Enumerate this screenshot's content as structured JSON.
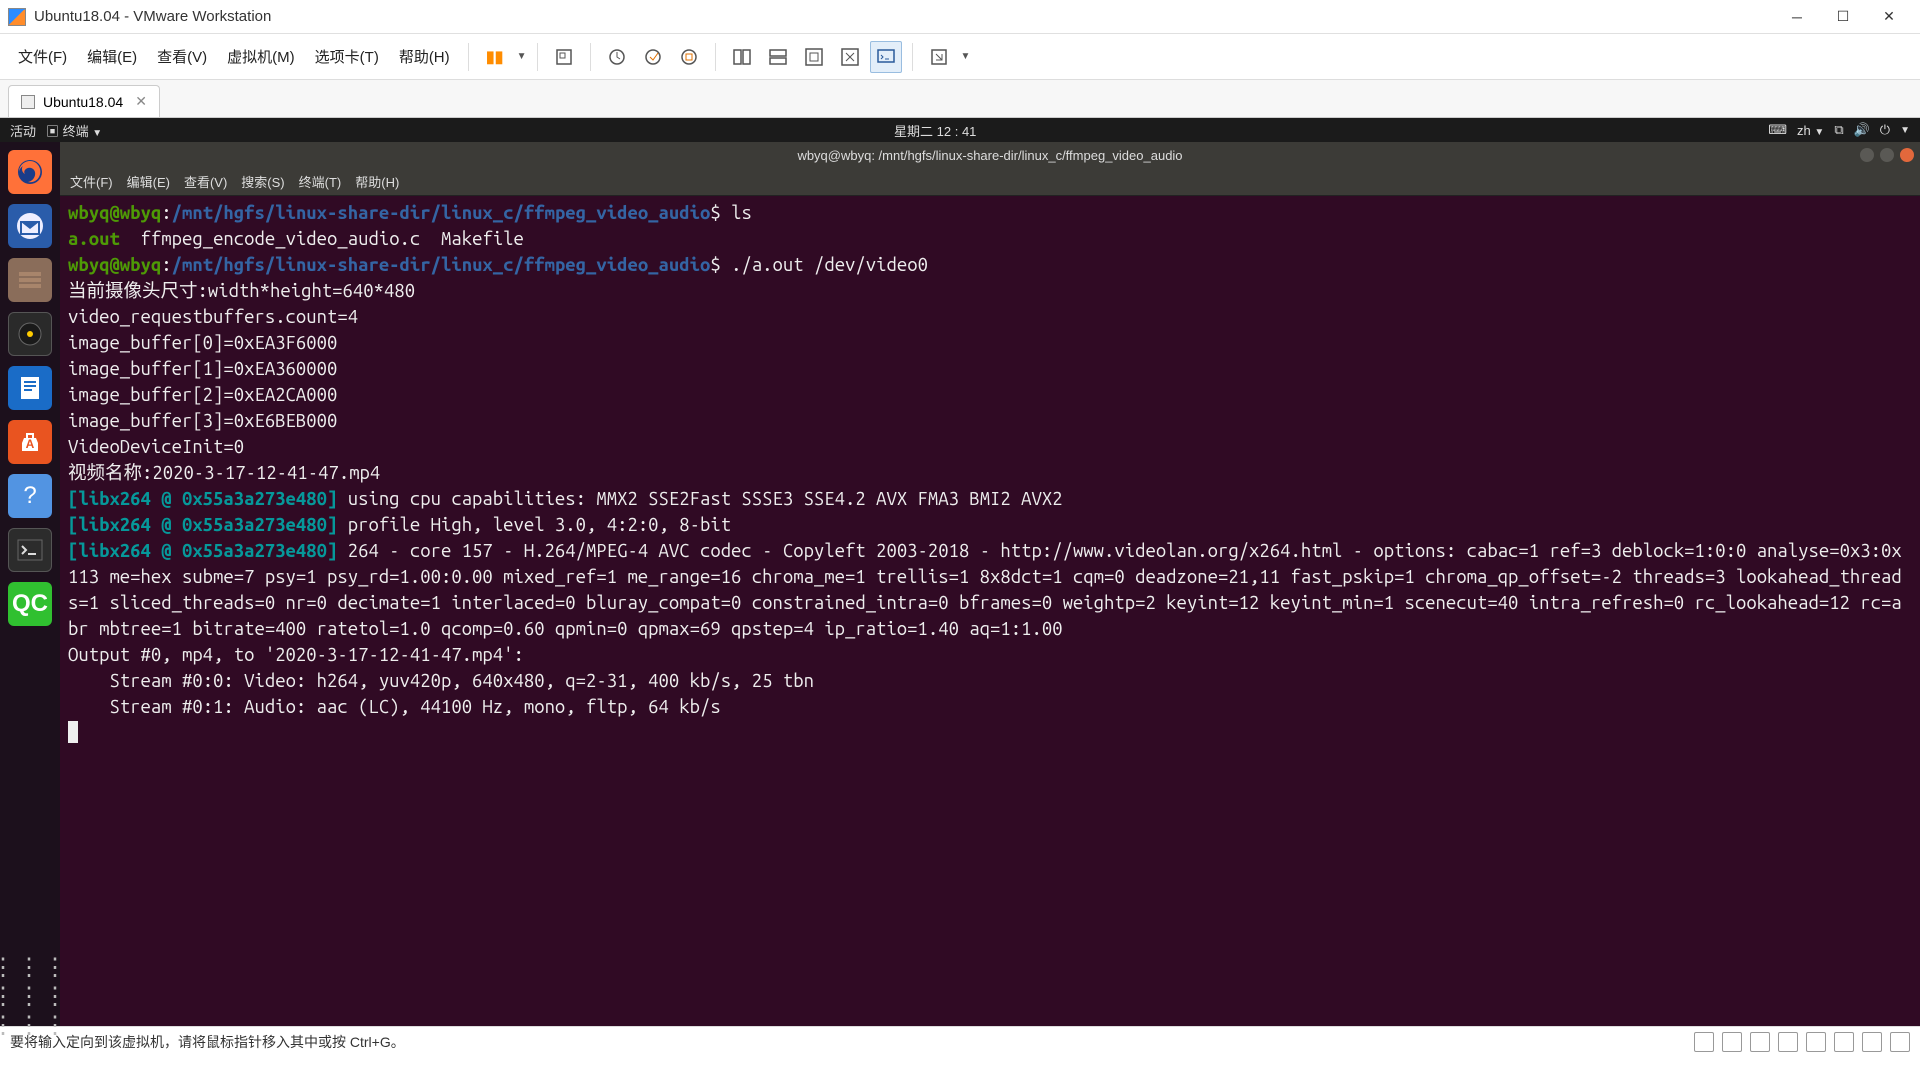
{
  "vmware": {
    "title": "Ubuntu18.04 - VMware Workstation",
    "menus": [
      "文件(F)",
      "编辑(E)",
      "查看(V)",
      "虚拟机(M)",
      "选项卡(T)",
      "帮助(H)"
    ],
    "tab_label": "Ubuntu18.04",
    "statusbar": "要将输入定向到该虚拟机，请将鼠标指针移入其中或按 Ctrl+G。"
  },
  "ubuntu_topbar": {
    "activities": "活动",
    "terminal_label": "终端",
    "datetime": "星期二 12 : 41",
    "lang": "zh"
  },
  "dock": {
    "qc_label": "QC"
  },
  "terminal": {
    "window_title": "wbyq@wbyq: /mnt/hgfs/linux-share-dir/linux_c/ffmpeg_video_audio",
    "menus": [
      "文件(F)",
      "编辑(E)",
      "查看(V)",
      "搜索(S)",
      "终端(T)",
      "帮助(H)"
    ],
    "prompt_user": "wbyq@wbyq",
    "prompt_path": "/mnt/hgfs/linux-share-dir/linux_c/ffmpeg_video_audio",
    "cmd_ls": "ls",
    "ls_out_aout": "a.out",
    "ls_out_src": "ffmpeg_encode_video_audio.c",
    "ls_out_make": "Makefile",
    "cmd_run": "./a.out /dev/video0",
    "line_camera": "当前摄像头尺寸:width*height=640*480",
    "line_reqbuf": "video_requestbuffers.count=4",
    "line_buf0": "image_buffer[0]=0xEA3F6000",
    "line_buf1": "image_buffer[1]=0xEA360000",
    "line_buf2": "image_buffer[2]=0xEA2CA000",
    "line_buf3": "image_buffer[3]=0xE6BEB000",
    "line_devinit": "VideoDeviceInit=0",
    "line_videoname": "视频名称:2020-3-17-12-41-47.mp4",
    "libx264_tag": "[libx264 @ 0x55a3a273e480]",
    "libx264_cpu": " using cpu capabilities: MMX2 SSE2Fast SSSE3 SSE4.2 AVX FMA3 BMI2 AVX2",
    "libx264_profile": " profile High, level 3.0, 4:2:0, 8-bit",
    "libx264_core": " 264 - core 157 - H.264/MPEG-4 AVC codec - Copyleft 2003-2018 - http://www.videolan.org/x264.html - options: cabac=1 ref=3 deblock=1:0:0 analyse=0x3:0x113 me=hex subme=7 psy=1 psy_rd=1.00:0.00 mixed_ref=1 me_range=16 chroma_me=1 trellis=1 8x8dct=1 cqm=0 deadzone=21,11 fast_pskip=1 chroma_qp_offset=-2 threads=3 lookahead_threads=1 sliced_threads=0 nr=0 decimate=1 interlaced=0 bluray_compat=0 constrained_intra=0 bframes=0 weightp=2 keyint=12 keyint_min=1 scenecut=40 intra_refresh=0 rc_lookahead=12 rc=abr mbtree=1 bitrate=400 ratetol=1.0 qcomp=0.60 qpmin=0 qpmax=69 qpstep=4 ip_ratio=1.40 aq=1:1.00",
    "line_output": "Output #0, mp4, to '2020-3-17-12-41-47.mp4':",
    "line_stream0": "    Stream #0:0: Video: h264, yuv420p, 640x480, q=2-31, 400 kb/s, 25 tbn",
    "line_stream1": "    Stream #0:1: Audio: aac (LC), 44100 Hz, mono, fltp, 64 kb/s"
  }
}
